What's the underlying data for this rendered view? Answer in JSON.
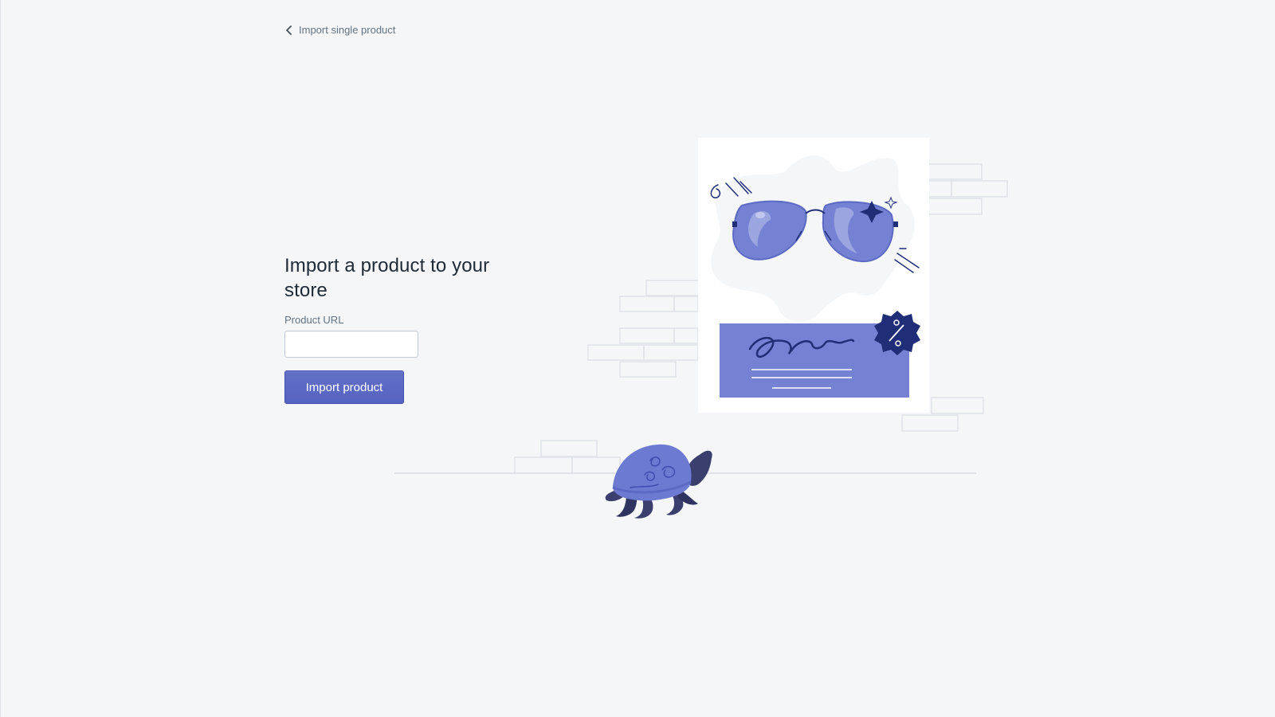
{
  "breadcrumb": {
    "label": "Import single product"
  },
  "main": {
    "title": "Import a product to your store",
    "field_label": "Product URL",
    "input_value": "",
    "input_placeholder": "",
    "button_label": "Import product"
  },
  "colors": {
    "accent": "#5c6ac4",
    "accent_dark": "#202e78",
    "background": "#f4f6f8",
    "text": "#212b36",
    "muted": "#637381"
  },
  "illustration": {
    "icons": [
      "sunglasses-icon",
      "coupon-card-icon",
      "percent-badge-icon",
      "turtle-icon",
      "brick-wall-icon"
    ]
  }
}
